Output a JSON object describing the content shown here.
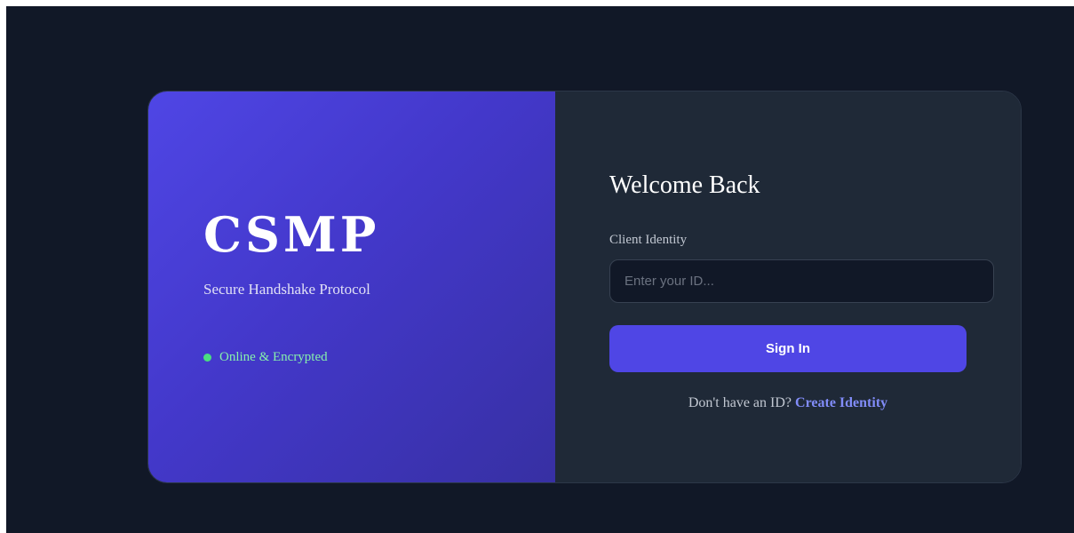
{
  "brand": {
    "title": "CSMP",
    "subtitle": "Secure Handshake Protocol",
    "status_text": "Online & Encrypted",
    "status_color": "#4ade80",
    "accent_gradient": [
      "#4f46e5",
      "#3730a3"
    ]
  },
  "form": {
    "heading": "Welcome Back",
    "identity_label": "Client Identity",
    "identity_value": "",
    "identity_placeholder": "Enter your ID...",
    "sign_in_label": "Sign In",
    "signup_prompt": "Don't have an ID?",
    "signup_link": "Create Identity",
    "button_color": "#4f46e5",
    "link_color": "#818cf8"
  },
  "theme": {
    "background": "#111827",
    "panel": "#1f2937"
  }
}
